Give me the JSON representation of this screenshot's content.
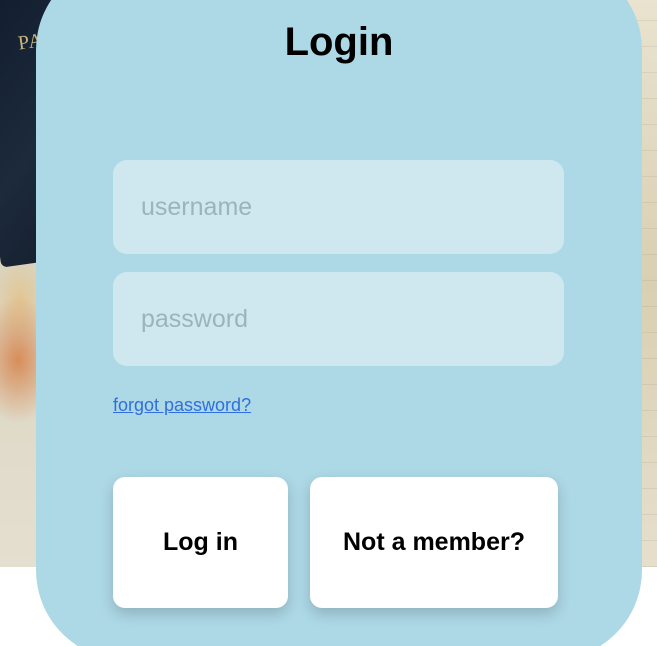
{
  "page": {
    "title": "Login"
  },
  "background": {
    "passport_text": "PAS"
  },
  "form": {
    "username_placeholder": "username",
    "password_placeholder": "password",
    "forgot_link": "forgot password?"
  },
  "buttons": {
    "login_label": "Log in",
    "signup_label": "Not a member?"
  },
  "colors": {
    "card": "#add8e6",
    "field": "#cfe8ef",
    "link": "#2f6fe0",
    "button": "#ffffff"
  }
}
